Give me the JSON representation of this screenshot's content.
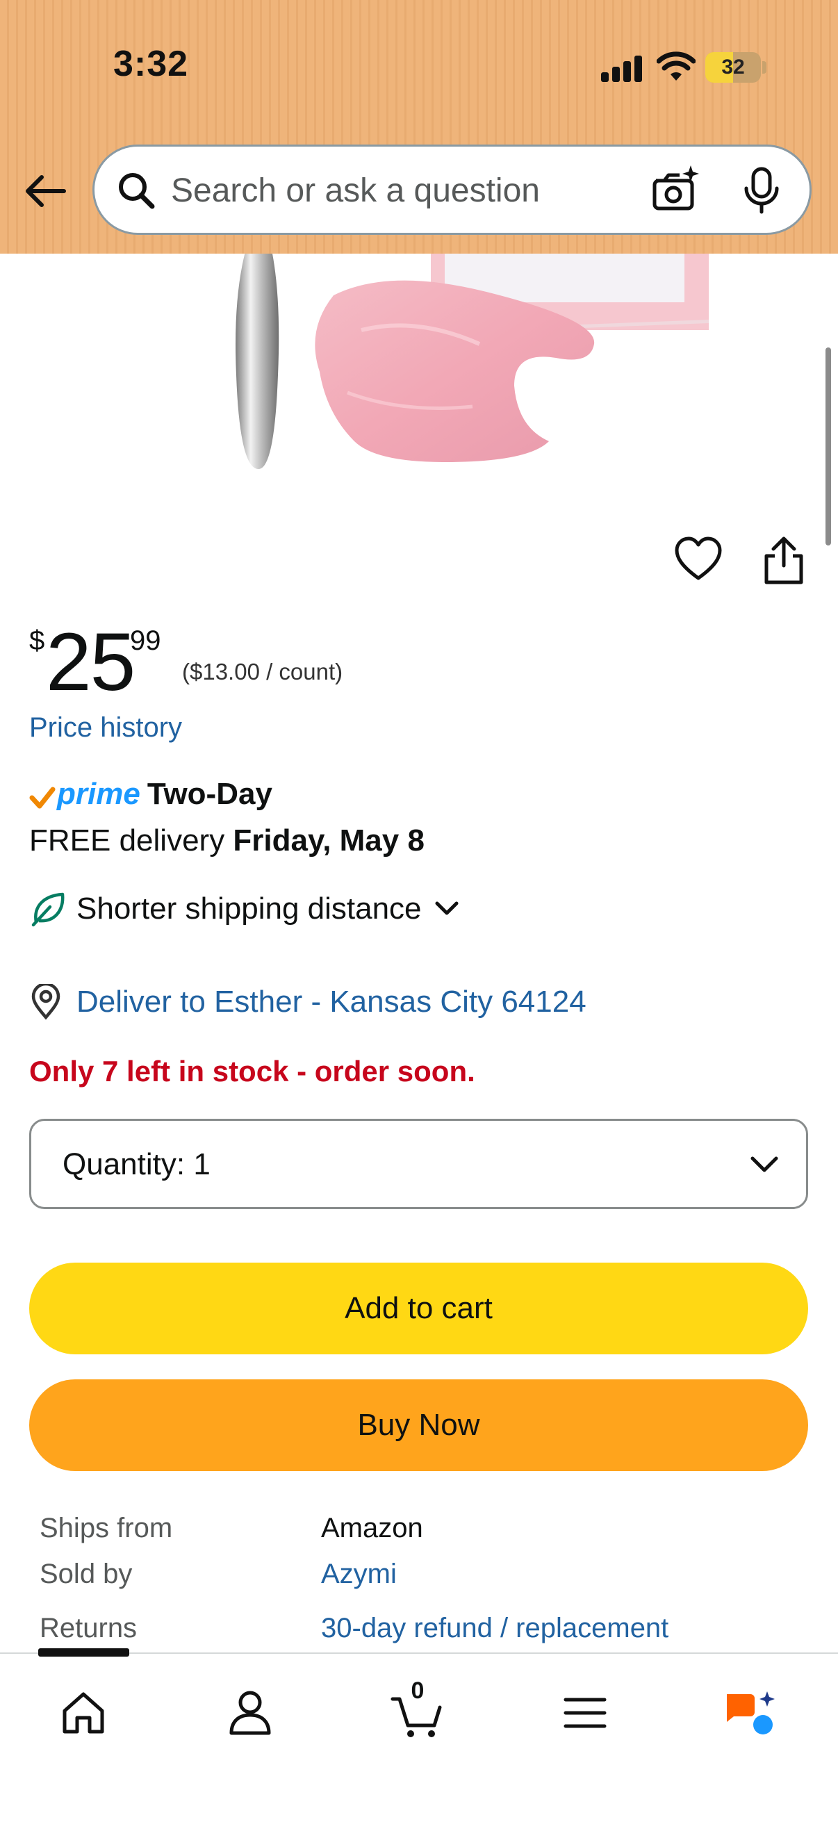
{
  "status_bar": {
    "time": "3:32",
    "battery": "32"
  },
  "search": {
    "placeholder": "Search or ask a question"
  },
  "price": {
    "currency": "$",
    "whole": "25",
    "fraction": "99",
    "unit_price": "($13.00 / count)"
  },
  "price_history": "Price history",
  "prime": {
    "brand": "prime",
    "label": "Two-Day"
  },
  "delivery": {
    "prefix": "FREE delivery ",
    "date": "Friday, May 8"
  },
  "shipping": {
    "label": "Shorter shipping distance"
  },
  "deliver_to": "Deliver to Esther - Kansas City 64124",
  "stock": "Only 7 left in stock - order soon.",
  "quantity": {
    "label": "Quantity:",
    "value": "1"
  },
  "buttons": {
    "add_to_cart": "Add to cart",
    "buy_now": "Buy Now"
  },
  "seller_info": {
    "ships_from_label": "Ships from",
    "ships_from_value": "Amazon",
    "sold_by_label": "Sold by",
    "sold_by_value": "Azymi",
    "returns_label": "Returns",
    "returns_value": "30-day refund / replacement"
  },
  "bottom_nav": {
    "cart_count": "0"
  },
  "colors": {
    "header_bg": "#efb47a",
    "link": "#2162a1",
    "stock_red": "#c7061c",
    "add_to_cart": "#ffd814",
    "buy_now": "#ffa41c",
    "prime_blue": "#1a98ff",
    "prime_check": "#f08804"
  }
}
